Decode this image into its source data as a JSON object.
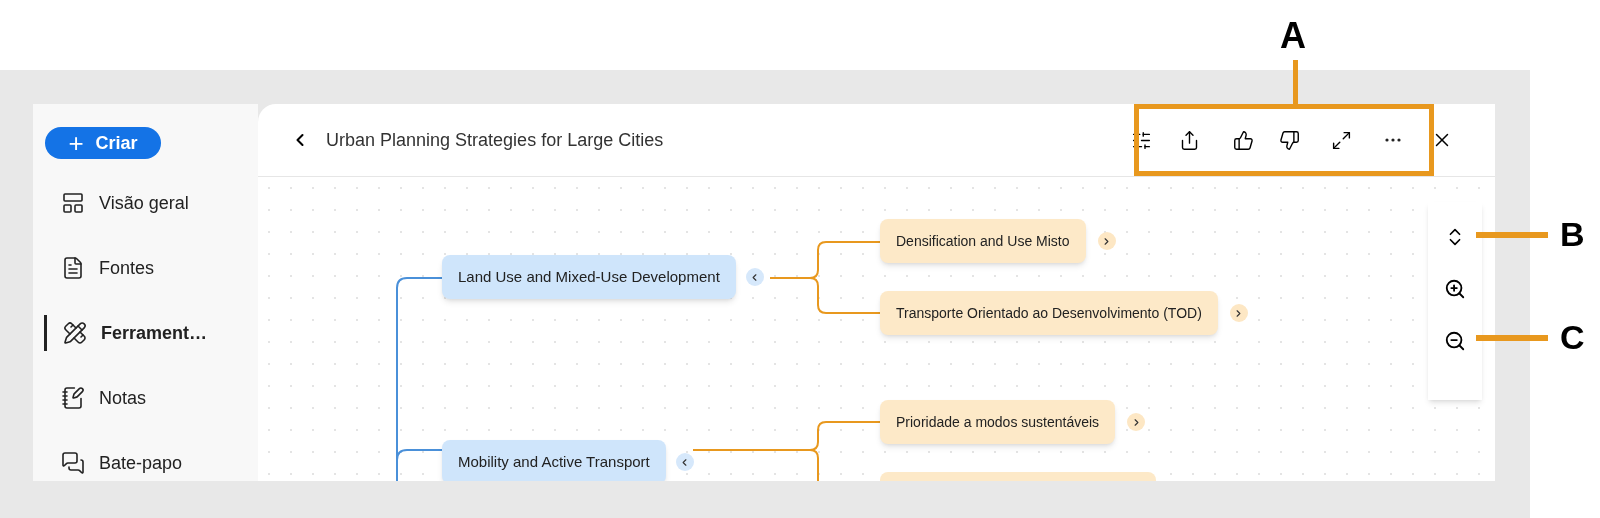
{
  "annotations": [
    {
      "label": "A",
      "kind": "top"
    },
    {
      "label": "B",
      "kind": "side"
    },
    {
      "label": "C",
      "kind": "side"
    }
  ],
  "sidebar": {
    "create_button": {
      "icon": "+",
      "label": "Criar"
    },
    "items": [
      {
        "label": "Visão geral",
        "kind": "overview",
        "selected": false
      },
      {
        "label": "Fontes",
        "kind": "sources",
        "selected": false
      },
      {
        "label": "Ferrament…",
        "kind": "tools",
        "selected": true
      },
      {
        "label": "Notas",
        "kind": "notes",
        "selected": false
      },
      {
        "label": "Bate-papo",
        "kind": "chat",
        "selected": false
      }
    ]
  },
  "header": {
    "title": "Urban Planning Strategies for Large Cities"
  },
  "mind_map": {
    "branches": [
      {
        "label": "Land Use and Mixed-Use Development",
        "expanded": true,
        "children": [
          {
            "kind": "node",
            "label": "Densification and Use Misto",
            "expanded": false
          },
          {
            "kind": "node",
            "label": "Transporte Orientado ao Desenvolvimento (TOD)",
            "expanded": false
          }
        ]
      },
      {
        "label": "Mobility and Active Transport",
        "expanded": true,
        "children": [
          {
            "kind": "node",
            "label": "Prioridade a modos sustentáveis",
            "expanded": false
          },
          {
            "kind": "cut"
          }
        ]
      }
    ]
  }
}
